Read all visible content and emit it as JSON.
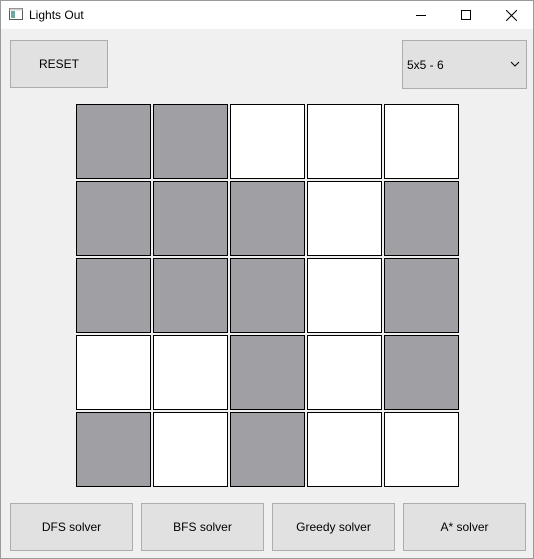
{
  "window": {
    "title": "Lights Out"
  },
  "toolbar": {
    "reset_label": "RESET",
    "level_select_value": "5x5 - 6"
  },
  "board": {
    "rows": 5,
    "cols": 5,
    "cells": [
      [
        1,
        1,
        0,
        0,
        0
      ],
      [
        1,
        1,
        1,
        0,
        1
      ],
      [
        1,
        1,
        1,
        0,
        1
      ],
      [
        0,
        0,
        1,
        0,
        1
      ],
      [
        1,
        0,
        1,
        0,
        0
      ]
    ],
    "on_color": "#a0a0a4",
    "off_color": "#ffffff"
  },
  "solvers": {
    "dfs_label": "DFS solver",
    "bfs_label": "BFS solver",
    "greedy_label": "Greedy solver",
    "astar_label": "A* solver"
  }
}
